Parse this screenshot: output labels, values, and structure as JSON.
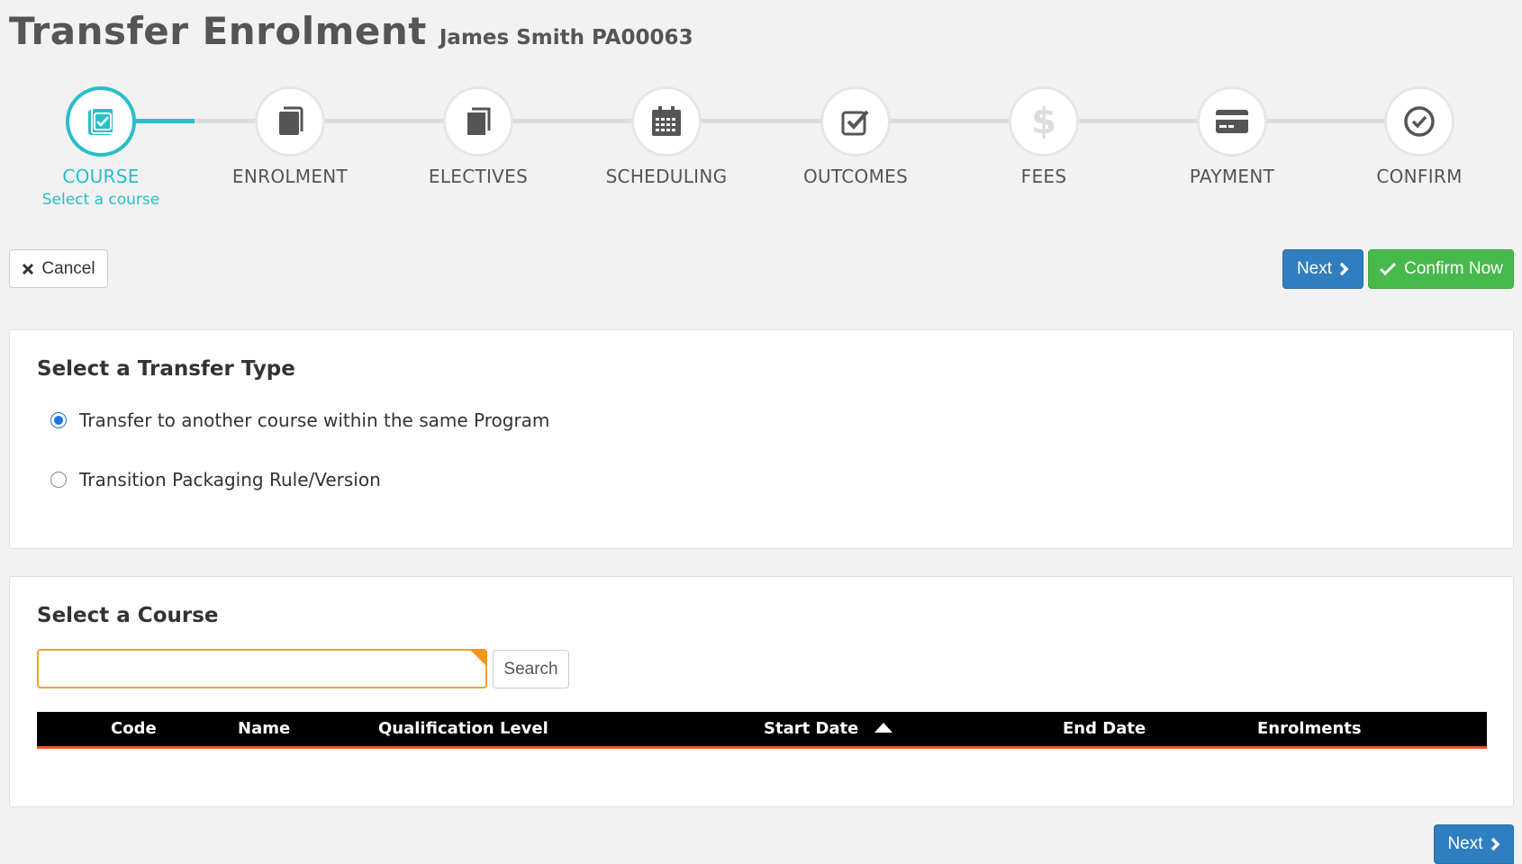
{
  "header": {
    "title": "Transfer Enrolment",
    "subtitle": "James Smith PA00063"
  },
  "wizard": {
    "steps": [
      {
        "label": "COURSE",
        "sublabel": "Select a course",
        "icon": "checkbox-book-icon",
        "active": true
      },
      {
        "label": "ENROLMENT",
        "icon": "book-icon"
      },
      {
        "label": "ELECTIVES",
        "icon": "copy-icon"
      },
      {
        "label": "SCHEDULING",
        "icon": "calendar-icon"
      },
      {
        "label": "OUTCOMES",
        "icon": "check-square-icon"
      },
      {
        "label": "FEES",
        "icon": "dollar-icon"
      },
      {
        "label": "PAYMENT",
        "icon": "credit-card-icon"
      },
      {
        "label": "CONFIRM",
        "icon": "check-circle-icon"
      }
    ]
  },
  "actions": {
    "cancel_label": "Cancel",
    "next_label": "Next",
    "confirm_label": "Confirm Now",
    "bottom_next_label": "Next"
  },
  "transfer_type": {
    "title": "Select a Transfer Type",
    "options": [
      {
        "label": "Transfer to another course within the same Program",
        "checked": true
      },
      {
        "label": "Transition Packaging Rule/Version",
        "checked": false
      }
    ]
  },
  "course": {
    "title": "Select a Course",
    "search_value": "",
    "search_button_label": "Search",
    "columns": [
      "Code",
      "Name",
      "Qualification Level",
      "Start Date",
      "End Date",
      "Enrolments"
    ],
    "sorted_column": "Start Date",
    "sort_direction": "ascending",
    "rows": []
  },
  "colors": {
    "accent": "#26bfc9",
    "primary": "#2f7ec0",
    "success": "#47b94b",
    "table_header": "#000000",
    "table_border": "#e05a1c",
    "input_border": "#f0a030"
  }
}
